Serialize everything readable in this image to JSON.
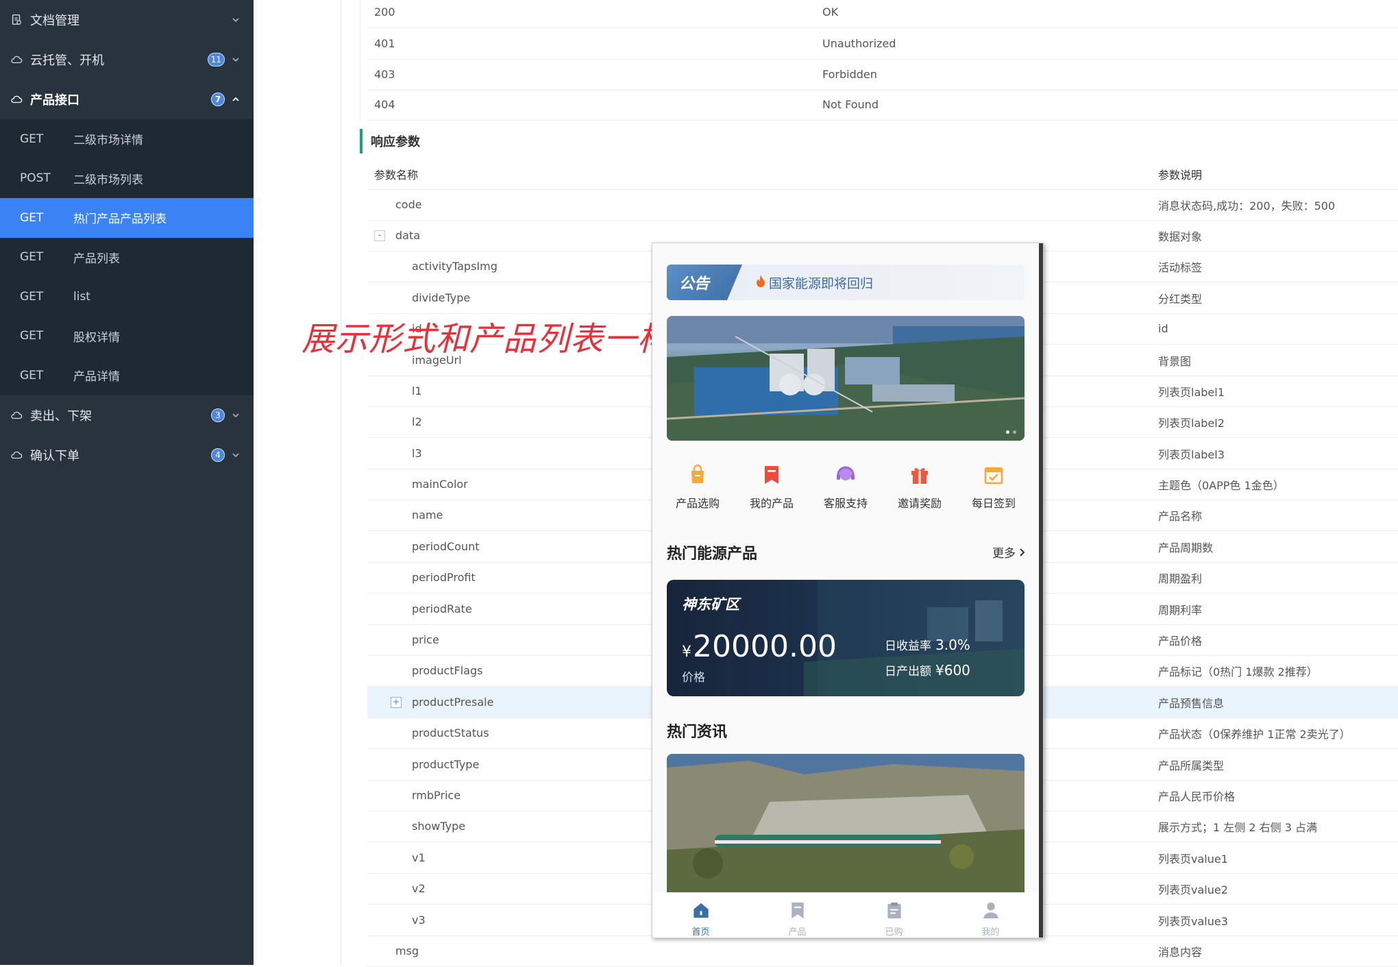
{
  "sidebar": {
    "groups": [
      {
        "label": "文档管理",
        "icon": "document-icon",
        "badge": ""
      },
      {
        "label": "云托管、开机",
        "icon": "cloud-icon",
        "badge": "11"
      },
      {
        "label": "产品接口",
        "icon": "cloud-icon",
        "badge": "7"
      },
      {
        "label": "卖出、下架",
        "icon": "cloud-icon",
        "badge": "3"
      },
      {
        "label": "确认下单",
        "icon": "cloud-icon",
        "badge": "4"
      }
    ],
    "endpoints": [
      {
        "method": "GET",
        "name": "二级市场详情"
      },
      {
        "method": "POST",
        "name": "二级市场列表"
      },
      {
        "method": "GET",
        "name": "热门产品产品列表"
      },
      {
        "method": "GET",
        "name": "产品列表"
      },
      {
        "method": "GET",
        "name": "list"
      },
      {
        "method": "GET",
        "name": "股权详情"
      },
      {
        "method": "GET",
        "name": "产品详情"
      }
    ]
  },
  "status_table": [
    {
      "code": "200",
      "desc": "OK"
    },
    {
      "code": "401",
      "desc": "Unauthorized"
    },
    {
      "code": "403",
      "desc": "Forbidden"
    },
    {
      "code": "404",
      "desc": "Not Found"
    }
  ],
  "response": {
    "section_title": "响应参数",
    "col_name": "参数名称",
    "col_desc": "参数说明",
    "rows": [
      {
        "name": "code",
        "desc": "消息状态码,成功：200，失败：500"
      },
      {
        "name": "data",
        "desc": "数据对象"
      },
      {
        "name": "activityTapsImg",
        "desc": "活动标签"
      },
      {
        "name": "divideType",
        "desc": "分红类型"
      },
      {
        "name": "id",
        "desc": "id"
      },
      {
        "name": "imageUrl",
        "desc": "背景图"
      },
      {
        "name": "l1",
        "desc": "列表页label1"
      },
      {
        "name": "l2",
        "desc": "列表页label2"
      },
      {
        "name": "l3",
        "desc": "列表页label3"
      },
      {
        "name": "mainColor",
        "desc": "主题色（0APP色 1金色）"
      },
      {
        "name": "name",
        "desc": "产品名称"
      },
      {
        "name": "periodCount",
        "desc": "产品周期数"
      },
      {
        "name": "periodProfit",
        "desc": "周期盈利"
      },
      {
        "name": "periodRate",
        "desc": "周期利率"
      },
      {
        "name": "price",
        "desc": "产品价格"
      },
      {
        "name": "productFlags",
        "desc": "产品标记（0热门 1爆款 2推荐）"
      },
      {
        "name": "productPresale",
        "desc": "产品预售信息"
      },
      {
        "name": "productStatus",
        "desc": "产品状态（0保养维护 1正常 2卖光了）"
      },
      {
        "name": "productType",
        "desc": "产品所属类型"
      },
      {
        "name": "rmbPrice",
        "desc": "产品人民币价格"
      },
      {
        "name": "showType",
        "desc": "展示方式；1 左侧 2 右侧 3 占满"
      },
      {
        "name": "v1",
        "desc": "列表页value1"
      },
      {
        "name": "v2",
        "desc": "列表页value2"
      },
      {
        "name": "v3",
        "desc": "列表页value3"
      },
      {
        "name": "msg",
        "desc": "消息内容"
      }
    ],
    "collapse_symbol": "-",
    "expand_symbol": "+"
  },
  "annotation": "展示形式和产品列表一样",
  "phone": {
    "notice_tag": "公告",
    "notice_icon": "fire-icon",
    "notice_text": "国家能源即将回归",
    "quick_actions": [
      {
        "label": "产品选购",
        "icon": "shopping-bag-icon",
        "color": "#f5a93b"
      },
      {
        "label": "我的产品",
        "icon": "bookmark-icon",
        "color": "#ee4a3d"
      },
      {
        "label": "客服支持",
        "icon": "headset-icon",
        "color": "#9b63e0"
      },
      {
        "label": "邀请奖励",
        "icon": "gift-icon",
        "color": "#f0583d"
      },
      {
        "label": "每日签到",
        "icon": "calendar-check-icon",
        "color": "#f5a93b"
      }
    ],
    "hot_products_title": "热门能源产品",
    "more_label": "更多",
    "product": {
      "name": "神东矿区",
      "currency": "¥",
      "price": "20000.00",
      "price_label": "价格",
      "rate_label": "日收益率",
      "rate_value": "3.0%",
      "output_label": "日产出额",
      "output_value": "¥600"
    },
    "news_title": "热门资讯",
    "tabs": [
      {
        "label": "首页",
        "icon": "home-icon"
      },
      {
        "label": "产品",
        "icon": "bookmark-icon"
      },
      {
        "label": "已购",
        "icon": "clipboard-icon"
      },
      {
        "label": "我的",
        "icon": "user-icon"
      }
    ]
  },
  "colors": {
    "sidebar_bg": "#28333e",
    "active_item": "#3b82f5",
    "section_accent": "#1aa37a",
    "annotation": "#e8303a"
  }
}
